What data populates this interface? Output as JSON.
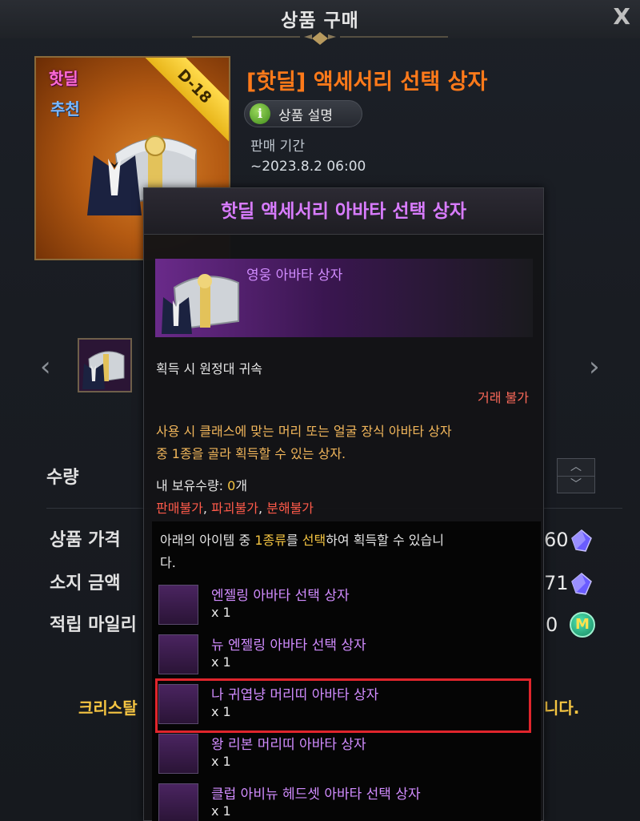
{
  "header": {
    "title": "상품 구매",
    "close_label": "X"
  },
  "product": {
    "badge_hot": "핫딜",
    "badge_recommend": "추천",
    "ribbon": "D-18",
    "title": "[핫딜] 액세서리 선택 상자",
    "description_button": "상품 설명",
    "sale_period_label": "판매 기간",
    "sale_period_value": "~2023.8.2  06:00"
  },
  "form": {
    "quantity_label": "수량",
    "price_label": "상품 가격",
    "price_value": "60",
    "balance_label": "소지 금액",
    "balance_value": "71",
    "mileage_label": "적립 마일리",
    "mileage_value": "0",
    "notice_left": "크리스탈",
    "notice_right": "니다."
  },
  "tooltip": {
    "title": "핫딜 액세서리 아바타 선택 상자",
    "item_name": "영웅 아바타 상자",
    "bound": "획득 시 원정대 귀속",
    "trade": "거래 불가",
    "desc_line1": "사용 시 클래스에 맞는 머리 또는 얼굴 장식 아바타 상자",
    "desc_line2": "중 1종을 골라 획득할 수 있는 상자.",
    "owned_label": "내 보유수량: ",
    "owned_value": "0",
    "owned_unit": "개",
    "restrict_1": "판매불가",
    "restrict_2": "파괴불가",
    "restrict_3": "분해불가",
    "select_pre": "아래의 아이템 중 ",
    "select_highlight_1": "1종류",
    "select_mid": "를 ",
    "select_highlight_2": "선택",
    "select_post": "하여 획득할 수 있습니",
    "select_line2": "다.",
    "options": [
      {
        "name": "엔젤링 아바타 선택 상자",
        "qty": "x 1"
      },
      {
        "name": "뉴 엔젤링 아바타 선택 상자",
        "qty": "x 1"
      },
      {
        "name": "나 귀엽냥 머리띠 아바타 상자",
        "qty": "x 1"
      },
      {
        "name": "왕 리본 머리띠 아바타 상자",
        "qty": "x 1"
      },
      {
        "name": "클럽 아비뉴 헤드셋 아바타 선택 상자",
        "qty": "x 1"
      }
    ]
  },
  "colors": {
    "title_orange": "#ff7a1a",
    "tooltip_purple": "#d97cff",
    "highlight_red": "#e0252c",
    "restrict_red": "#ff5a4a",
    "gold": "#f5c542"
  }
}
